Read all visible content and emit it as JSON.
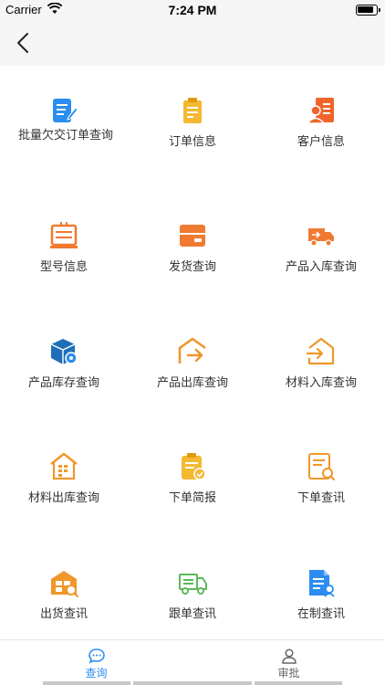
{
  "status_bar": {
    "carrier": "Carrier",
    "time": "7:24 PM"
  },
  "nav": {
    "back_icon": "chevron-left-icon"
  },
  "menu": [
    {
      "label": "批量欠交订单查询",
      "icon": "batch-order-doc-icon",
      "color": "#2c8cf0"
    },
    {
      "label": "订单信息",
      "icon": "order-clipboard-icon",
      "color": "#f5b833"
    },
    {
      "label": "客户信息",
      "icon": "customer-card-icon",
      "color": "#f0652a"
    },
    {
      "label": "型号信息",
      "icon": "model-device-icon",
      "color": "#f07a30"
    },
    {
      "label": "发货查询",
      "icon": "shipping-box-icon",
      "color": "#f07a30"
    },
    {
      "label": "产品入库查询",
      "icon": "delivery-truck-icon",
      "color": "#f07a30"
    },
    {
      "label": "产品库存查询",
      "icon": "inventory-cube-icon",
      "color": "#1f6fb8"
    },
    {
      "label": "产品出库查询",
      "icon": "warehouse-out-icon",
      "color": "#f0972a"
    },
    {
      "label": "材料入库查询",
      "icon": "warehouse-in-icon",
      "color": "#f0972a"
    },
    {
      "label": "材料出库查询",
      "icon": "warehouse-grid-icon",
      "color": "#f0972a"
    },
    {
      "label": "下单简报",
      "icon": "order-brief-clipboard-icon",
      "color": "#f5b833"
    },
    {
      "label": "下单查讯",
      "icon": "document-search-icon",
      "color": "#f0972a"
    },
    {
      "label": "出货查讯",
      "icon": "shipment-warehouse-icon",
      "color": "#f0972a"
    },
    {
      "label": "跟单查讯",
      "icon": "tracking-truck-icon",
      "color": "#5cb85c"
    },
    {
      "label": "在制查讯",
      "icon": "wip-document-icon",
      "color": "#2c8cf0"
    }
  ],
  "tabs": [
    {
      "label": "查询",
      "icon": "chat-bubble-icon",
      "active": true
    },
    {
      "label": "审批",
      "icon": "person-icon",
      "active": false
    }
  ],
  "colors": {
    "accent": "#2c8cf0"
  }
}
